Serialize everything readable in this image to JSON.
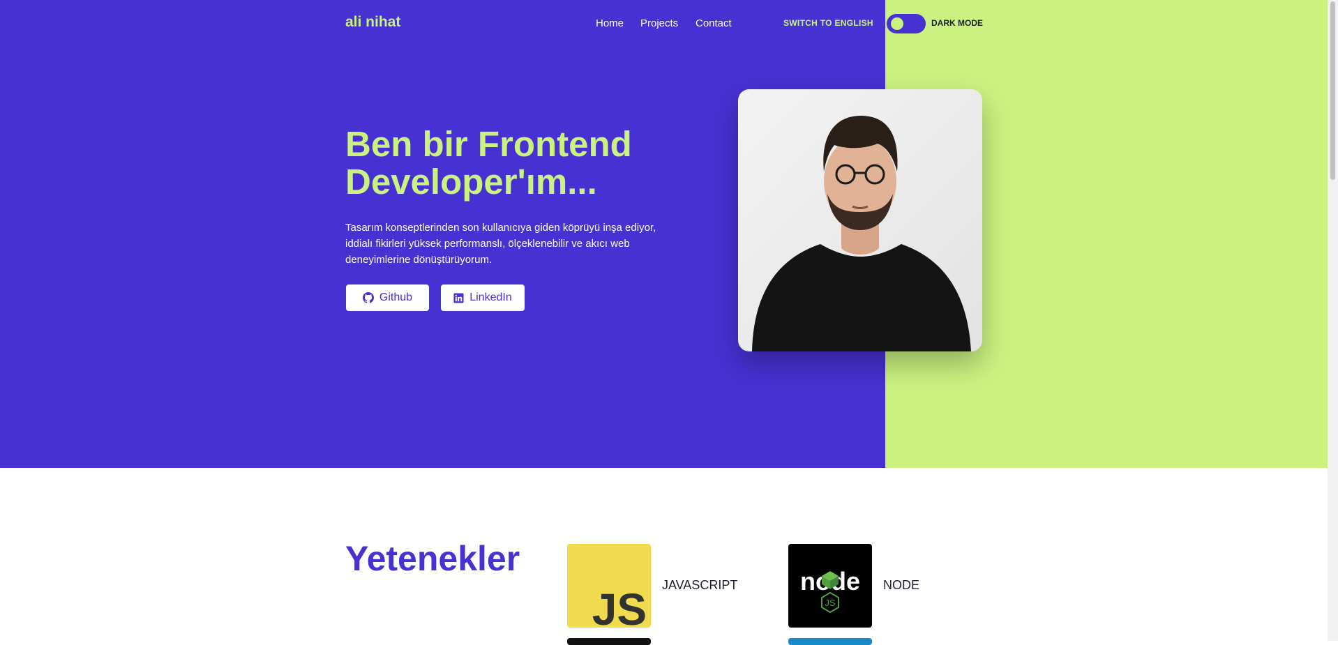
{
  "header": {
    "logo": "ali nihat",
    "nav": [
      "Home",
      "Projects",
      "Contact"
    ],
    "language_switch": "SWITCH TO ENGLISH",
    "dark_mode_label": "DARK MODE"
  },
  "hero": {
    "headline": "Ben bir Frontend Developer'ım...",
    "intro": "Tasarım konseptlerinden son kullanıcıya giden köprüyü inşa ediyor, iddialı fikirleri yüksek performanslı, ölçeklenebilir ve akıcı web deneyimlerine dönüştürüyorum.",
    "buttons": [
      {
        "label": "Github",
        "icon": "github-icon"
      },
      {
        "label": "LinkedIn",
        "icon": "linkedin-icon"
      }
    ],
    "photo": "profile-photo"
  },
  "skills": {
    "title": "Yetenekler",
    "items": [
      {
        "label": "JAVASCRIPT",
        "logo_text": "JS"
      },
      {
        "label": "NODE",
        "logo_text": "node",
        "badge_text": "JS"
      }
    ]
  },
  "colors": {
    "primary": "#4731d3",
    "accent": "#cbf281",
    "dark_text": "#1f1f2e"
  }
}
